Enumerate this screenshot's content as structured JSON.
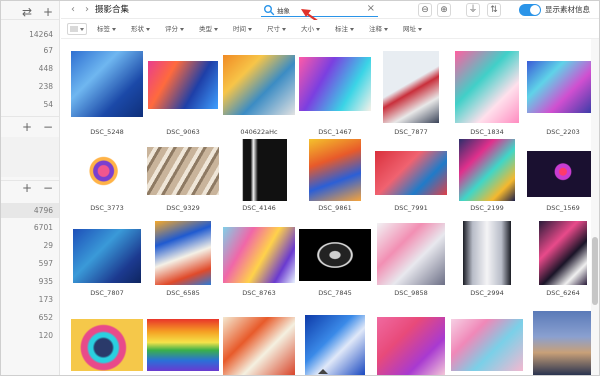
{
  "sidebar": {
    "top_controls": [
      "⇄",
      "+"
    ],
    "counts_top": [
      "14264",
      "67",
      "448",
      "238",
      "54"
    ],
    "mid_controls": [
      "+",
      "−"
    ],
    "lower_controls": [
      "+",
      "−"
    ],
    "counts_bottom": [
      "4796",
      "6701",
      "29",
      "597",
      "935",
      "173",
      "652",
      "120"
    ],
    "highlight_index": 0
  },
  "topbar": {
    "back_icon": "‹",
    "forward_icon": "›",
    "title": "摄影合集",
    "search": {
      "value": "抽象",
      "placeholder": ""
    },
    "clear_icon": "×",
    "zoom_out_icon": "⊖",
    "zoom_in_icon": "⊕",
    "filter_icon": "⏚",
    "sort_icon": "⇅",
    "toggle_on": true,
    "toggle_label": "显示素材信息"
  },
  "filters": [
    "标签",
    "形状",
    "评分",
    "类型",
    "时间",
    "尺寸",
    "大小",
    "标注",
    "注释",
    "网址"
  ],
  "grid": {
    "rows": [
      [
        "DSC_5248",
        "DSC_9063",
        "040622aHc",
        "DSC_1467",
        "DSC_7877",
        "DSC_1834",
        "DSC_2203"
      ],
      [
        "DSC_3773",
        "DSC_9329",
        "DSC_4146",
        "DSC_9861",
        "DSC_7991",
        "DSC_2199",
        "DSC_1569"
      ],
      [
        "DSC_7807",
        "DSC_6585",
        "DSC_8763",
        "DSC_7845",
        "DSC_9858",
        "DSC_2994",
        "DSC_6264"
      ],
      [
        "",
        "",
        "",
        "",
        "",
        "",
        ""
      ]
    ]
  },
  "colors": {
    "accent": "#2a94e8",
    "arrow": "#e0322b"
  }
}
